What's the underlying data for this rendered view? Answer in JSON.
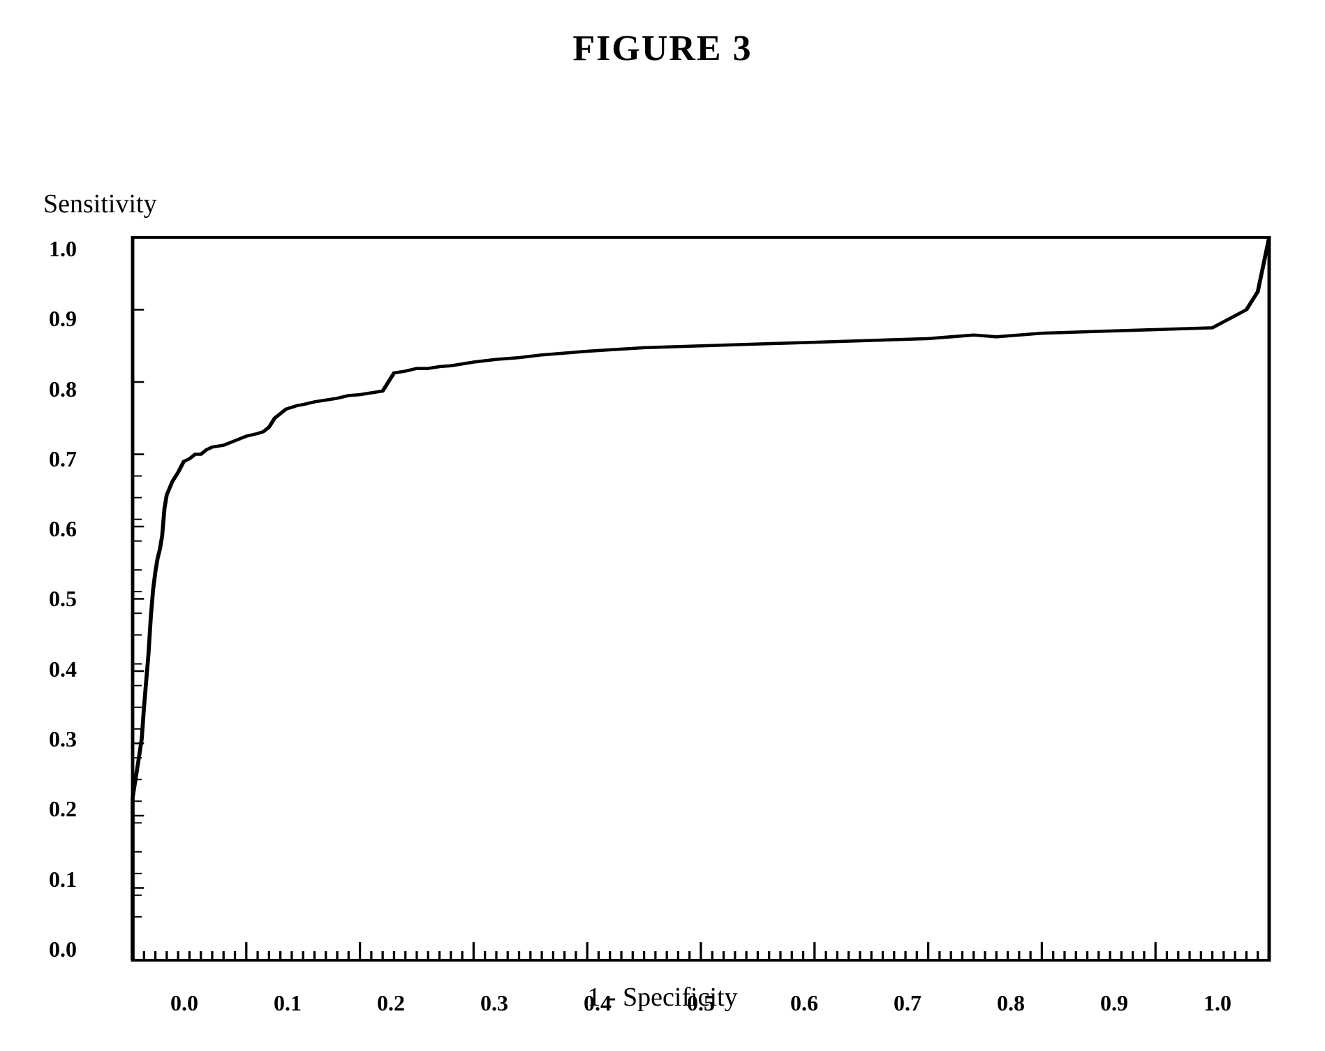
{
  "title": "FIGURE 3",
  "chart": {
    "y_axis_label": "Sensitivity",
    "x_axis_label": "1 - Specificity",
    "y_labels": [
      "0.0",
      "0.1",
      "0.2",
      "0.3",
      "0.4",
      "0.5",
      "0.6",
      "0.7",
      "0.8",
      "0.9",
      "1.0"
    ],
    "x_labels": [
      "0.0",
      "0.1",
      "0.2",
      "0.3",
      "0.4",
      "0.5",
      "0.6",
      "0.7",
      "0.8",
      "0.9",
      "1.0"
    ],
    "border_color": "#000000",
    "curve_color": "#000000"
  }
}
